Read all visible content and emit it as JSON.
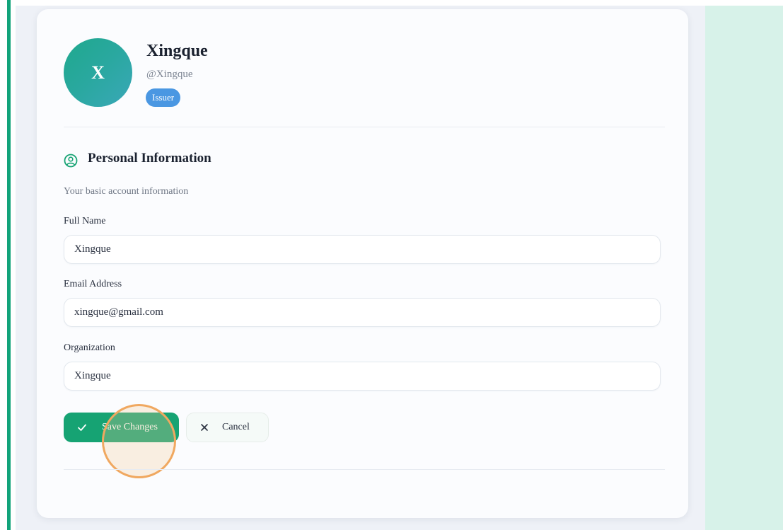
{
  "colors": {
    "accent_green": "#16a373",
    "edge_bar": "#12a37a",
    "right_panel": "#d7f2e9",
    "badge_blue": "#4a97e2",
    "avatar_teal": "#2aa8a0",
    "click_ring": "#f0a860"
  },
  "profile": {
    "avatar_initial": "X",
    "name": "Xingque",
    "handle": "@Xingque",
    "role_badge": "Issuer"
  },
  "section": {
    "icon": "user-circle-icon",
    "title": "Personal Information",
    "subtitle": "Your basic account information"
  },
  "form": {
    "full_name": {
      "label": "Full Name",
      "value": "Xingque"
    },
    "email": {
      "label": "Email Address",
      "value": "xingque@gmail.com"
    },
    "organization": {
      "label": "Organization",
      "value": "Xingque"
    }
  },
  "actions": {
    "save": {
      "label": "Save Changes",
      "icon": "check-icon"
    },
    "cancel": {
      "label": "Cancel",
      "icon": "close-icon"
    }
  }
}
